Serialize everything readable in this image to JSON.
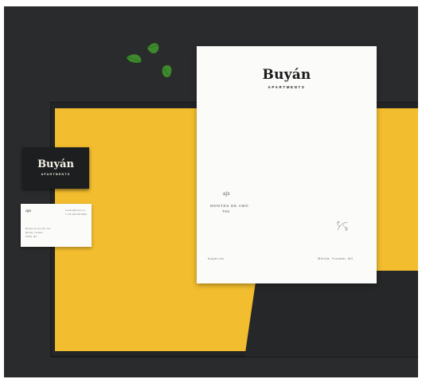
{
  "letterhead": {
    "brand": "Buyán",
    "subtitle": "APARTMENTS",
    "monogram": "ajs",
    "address_line1": "MONTES DE AMO",
    "address_line2": "T60",
    "footer_left": "buyan.mx",
    "footer_right": "Mérida, Yucatán, MX"
  },
  "business_card_black": {
    "brand": "Buyán",
    "subtitle": "APARTMENTS"
  },
  "business_card_white": {
    "monogram": "ajs",
    "contact_line1": "contact@buyan.mx",
    "contact_line2": "T +52 999 999 9999",
    "address_line1": "Montes de Amo 60, Col.",
    "address_line2": "Mérida, Yucatán",
    "address_line3": "97000, MX"
  },
  "colors": {
    "background": "#2a2b2c",
    "folder_yellow": "#f2bd2e",
    "paper": "#fbfbfa",
    "leaf": "#3c8a2b"
  }
}
